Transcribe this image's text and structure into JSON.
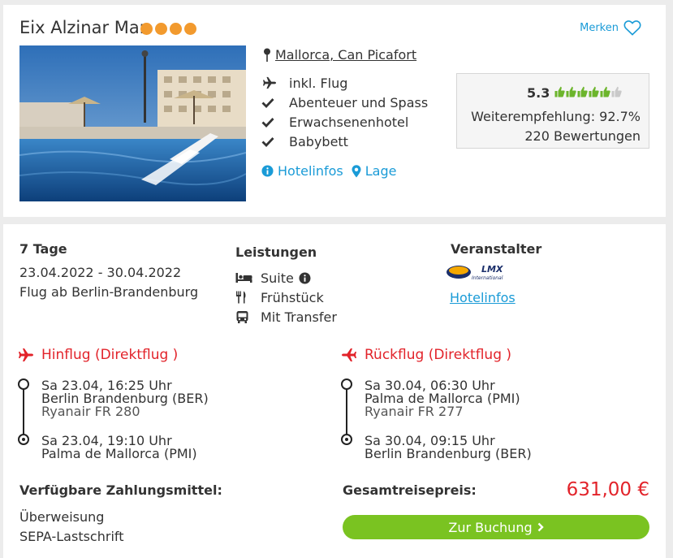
{
  "hotel": {
    "name": "Eix Alzinar Mar",
    "stars": 4,
    "merken_label": "Merken",
    "location": "Mallorca, Can Picafort",
    "features": [
      {
        "icon": "plane-icon",
        "label": "inkl. Flug"
      },
      {
        "icon": "check-icon",
        "label": "Abenteuer und Spass"
      },
      {
        "icon": "check-icon",
        "label": "Erwachsenenhotel"
      },
      {
        "icon": "check-icon",
        "label": "Babybett"
      }
    ],
    "links": {
      "hotelinfos": "Hotelinfos",
      "lage": "Lage"
    },
    "rating": {
      "score": "5.3",
      "thumbs_filled": 5.3,
      "thumbs_total": 6,
      "recommendation": "Weiterempfehlung: 92.7%",
      "reviews": "220 Bewertungen"
    }
  },
  "offer": {
    "duration": "7 Tage",
    "dates": "23.04.2022 - 30.04.2022",
    "departure": "Flug ab Berlin-Brandenburg",
    "leistungen_title": "Leistungen",
    "leistungen": [
      {
        "icon": "bed-icon",
        "label": "Suite"
      },
      {
        "icon": "cutlery-icon",
        "label": "Frühstück"
      },
      {
        "icon": "bus-icon",
        "label": "Mit Transfer"
      }
    ],
    "veranstalter_title": "Veranstalter",
    "veranstalter_logo": {
      "line1": "LMX",
      "line2": "International"
    },
    "veranstalter_link": "Hotelinfos"
  },
  "flights": {
    "outbound": {
      "title": "Hinflug (Direktflug )",
      "dep_time": "Sa 23.04, 16:25 Uhr",
      "dep_airport": "Berlin Brandenburg (BER)",
      "airline": "Ryanair FR 280",
      "arr_time": "Sa 23.04, 19:10 Uhr",
      "arr_airport": "Palma de Mallorca (PMI)"
    },
    "return": {
      "title": "Rückflug (Direktflug )",
      "dep_time": "Sa 30.04, 06:30 Uhr",
      "dep_airport": "Palma de Mallorca (PMI)",
      "airline": "Ryanair FR 277",
      "arr_time": "Sa 30.04, 09:15 Uhr",
      "arr_airport": "Berlin Brandenburg (BER)"
    }
  },
  "payment": {
    "title": "Verfügbare Zahlungsmittel:",
    "methods": [
      "Überweisung",
      "SEPA-Lastschrift"
    ]
  },
  "price": {
    "label": "Gesamtreisepreis:",
    "value": "631,00 €"
  },
  "booking_button": "Zur Buchung",
  "colors": {
    "accent_blue": "#1a9bd7",
    "red": "#e2232a",
    "green": "#7ac321",
    "star_orange": "#f29a2e"
  }
}
